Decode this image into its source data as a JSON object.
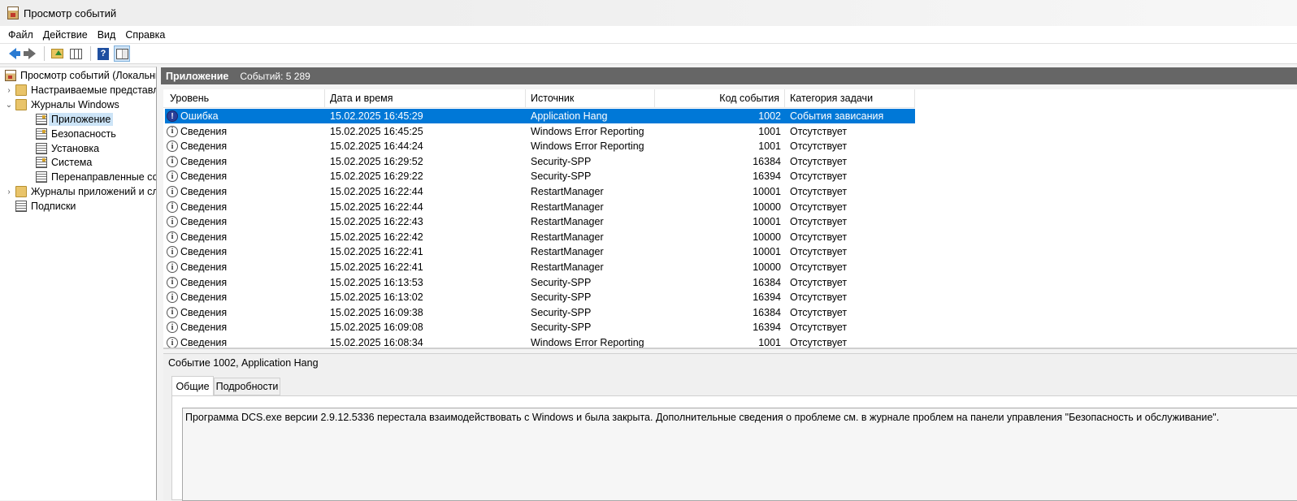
{
  "window": {
    "title": "Просмотр событий"
  },
  "menu": [
    "Файл",
    "Действие",
    "Вид",
    "Справка"
  ],
  "tree": {
    "root": "Просмотр событий (Локальный)",
    "custom_views": "Настраиваемые представления",
    "windows_logs": "Журналы Windows",
    "application": "Приложение",
    "security": "Безопасность",
    "setup": "Установка",
    "system": "Система",
    "forwarded": "Перенаправленные события",
    "app_service_logs": "Журналы приложений и служб",
    "subscriptions": "Подписки"
  },
  "header": {
    "title": "Приложение",
    "count": "Событий: 5 289"
  },
  "columns": {
    "level": "Уровень",
    "datetime": "Дата и время",
    "source": "Источник",
    "event_id": "Код события",
    "category": "Категория задачи"
  },
  "events": [
    {
      "level": "Ошибка",
      "datetime": "15.02.2025 16:45:29",
      "source": "Application Hang",
      "event_id": "1002",
      "category": "События зависания"
    },
    {
      "level": "Сведения",
      "datetime": "15.02.2025 16:45:25",
      "source": "Windows Error Reporting",
      "event_id": "1001",
      "category": "Отсутствует"
    },
    {
      "level": "Сведения",
      "datetime": "15.02.2025 16:44:24",
      "source": "Windows Error Reporting",
      "event_id": "1001",
      "category": "Отсутствует"
    },
    {
      "level": "Сведения",
      "datetime": "15.02.2025 16:29:52",
      "source": "Security-SPP",
      "event_id": "16384",
      "category": "Отсутствует"
    },
    {
      "level": "Сведения",
      "datetime": "15.02.2025 16:29:22",
      "source": "Security-SPP",
      "event_id": "16394",
      "category": "Отсутствует"
    },
    {
      "level": "Сведения",
      "datetime": "15.02.2025 16:22:44",
      "source": "RestartManager",
      "event_id": "10001",
      "category": "Отсутствует"
    },
    {
      "level": "Сведения",
      "datetime": "15.02.2025 16:22:44",
      "source": "RestartManager",
      "event_id": "10000",
      "category": "Отсутствует"
    },
    {
      "level": "Сведения",
      "datetime": "15.02.2025 16:22:43",
      "source": "RestartManager",
      "event_id": "10001",
      "category": "Отсутствует"
    },
    {
      "level": "Сведения",
      "datetime": "15.02.2025 16:22:42",
      "source": "RestartManager",
      "event_id": "10000",
      "category": "Отсутствует"
    },
    {
      "level": "Сведения",
      "datetime": "15.02.2025 16:22:41",
      "source": "RestartManager",
      "event_id": "10001",
      "category": "Отсутствует"
    },
    {
      "level": "Сведения",
      "datetime": "15.02.2025 16:22:41",
      "source": "RestartManager",
      "event_id": "10000",
      "category": "Отсутствует"
    },
    {
      "level": "Сведения",
      "datetime": "15.02.2025 16:13:53",
      "source": "Security-SPP",
      "event_id": "16384",
      "category": "Отсутствует"
    },
    {
      "level": "Сведения",
      "datetime": "15.02.2025 16:13:02",
      "source": "Security-SPP",
      "event_id": "16394",
      "category": "Отсутствует"
    },
    {
      "level": "Сведения",
      "datetime": "15.02.2025 16:09:38",
      "source": "Security-SPP",
      "event_id": "16384",
      "category": "Отсутствует"
    },
    {
      "level": "Сведения",
      "datetime": "15.02.2025 16:09:08",
      "source": "Security-SPP",
      "event_id": "16394",
      "category": "Отсутствует"
    },
    {
      "level": "Сведения",
      "datetime": "15.02.2025 16:08:34",
      "source": "Windows Error Reporting",
      "event_id": "1001",
      "category": "Отсутствует"
    }
  ],
  "details": {
    "title": "Событие 1002, Application Hang",
    "tab_general": "Общие",
    "tab_details": "Подробности",
    "description": "Программа DCS.exe версии 2.9.12.5336 перестала взаимодействовать с Windows и была закрыта. Дополнительные сведения о проблеме см. в журнале проблем на панели управления \"Безопасность и обслуживание\"."
  },
  "icons": [
    "back-arrow-icon",
    "forward-arrow-icon",
    "folder-up-icon",
    "show-hide-tree-icon",
    "help-icon",
    "action-pane-icon",
    "error-icon",
    "info-icon"
  ],
  "colors": {
    "selection": "#0078d7",
    "header_bar": "#666666",
    "tree_selection": "#cce4f7"
  }
}
